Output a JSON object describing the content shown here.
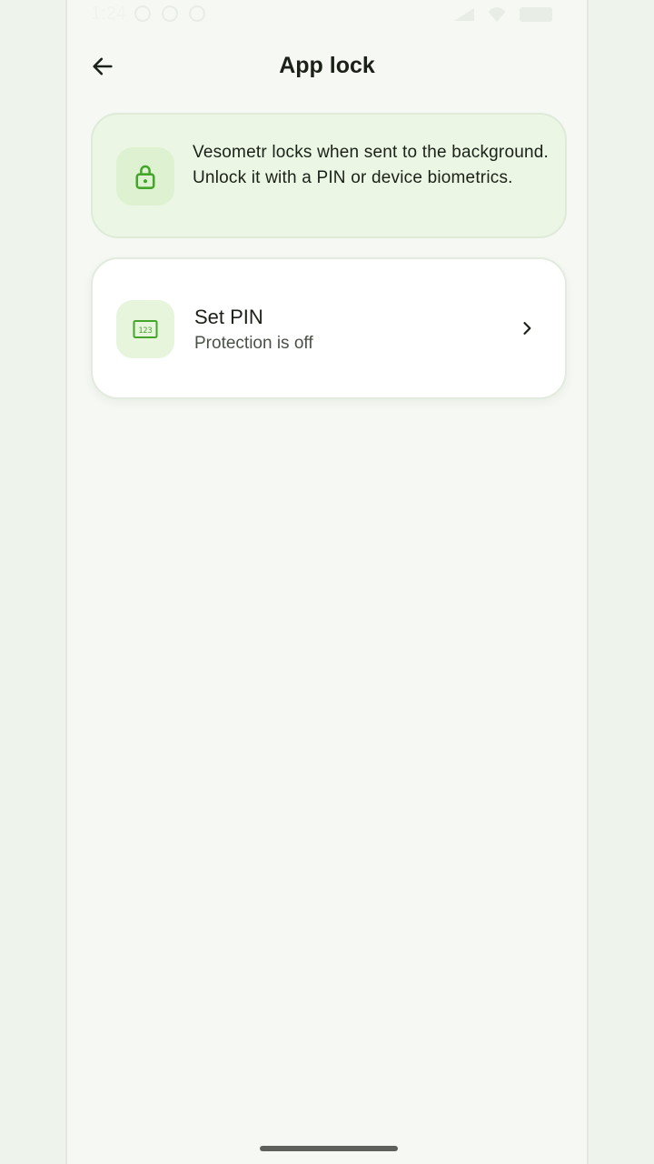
{
  "status": {
    "time": "1:24"
  },
  "header": {
    "title": "App lock",
    "back_icon": "arrow-left-icon"
  },
  "info_card": {
    "icon": "lock-icon",
    "text": "Vesometr locks when sent to the background. Unlock it with a PIN or device biometrics."
  },
  "pin_item": {
    "icon": "pin-pad-icon",
    "title": "Set PIN",
    "subtitle": "Protection is off",
    "chevron_icon": "chevron-right-icon"
  },
  "colors": {
    "accent": "#43a62b",
    "background": "#f5f8f3",
    "info_card_bg": "#ebf6e4",
    "icon_tile_bg": "#def2d2"
  }
}
